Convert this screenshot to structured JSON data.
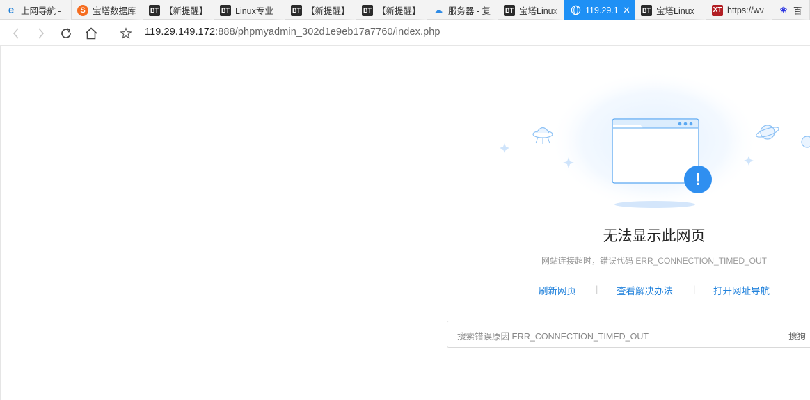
{
  "tabs": [
    {
      "label": "上网导航 -",
      "icon": "ie-e-icon",
      "favicon_text": "e"
    },
    {
      "label": "宝塔数据库",
      "icon": "sogou-icon",
      "favicon_text": "S"
    },
    {
      "label": "【新提醒】",
      "icon": "bt-icon",
      "favicon_text": "BT"
    },
    {
      "label": "Linux专业",
      "icon": "bt-icon",
      "favicon_text": "BT"
    },
    {
      "label": "【新提醒】",
      "icon": "bt-icon",
      "favicon_text": "BT"
    },
    {
      "label": "【新提醒】",
      "icon": "bt-icon",
      "favicon_text": "BT"
    },
    {
      "label": "服务器 - 复",
      "icon": "cloud-icon",
      "favicon_text": "☁"
    },
    {
      "label": "宝塔Linux",
      "icon": "bt-icon",
      "favicon_text": "BT"
    },
    {
      "label": "119.29.1",
      "icon": "globe-icon",
      "favicon_text": "",
      "active": true
    },
    {
      "label": "宝塔Linux",
      "icon": "bt-icon",
      "favicon_text": "BT"
    },
    {
      "label": "https://wv",
      "icon": "xt-icon",
      "favicon_text": "XT"
    },
    {
      "label": "百",
      "icon": "baidu-paw-icon",
      "favicon_text": "❀"
    }
  ],
  "toolbar": {
    "url_host": "119.29.149.172",
    "url_rest": ":888/phpmyadmin_302d1e9eb17a7760/index.php"
  },
  "error": {
    "title": "无法显示此网页",
    "description": "网站连接超时，错误代码 ERR_CONNECTION_TIMED_OUT",
    "actions": {
      "refresh": "刷新网页",
      "solutions": "查看解决办法",
      "navigation": "打开网址导航",
      "separator": "|"
    },
    "search": {
      "placeholder": "搜索错误原因 ERR_CONNECTION_TIMED_OUT",
      "button": "搜狗"
    },
    "illustration_icon": "!"
  },
  "colors": {
    "active_tab": "#1e90f5",
    "link": "#2383dc",
    "illustration_blue": "#2f8ff0"
  }
}
